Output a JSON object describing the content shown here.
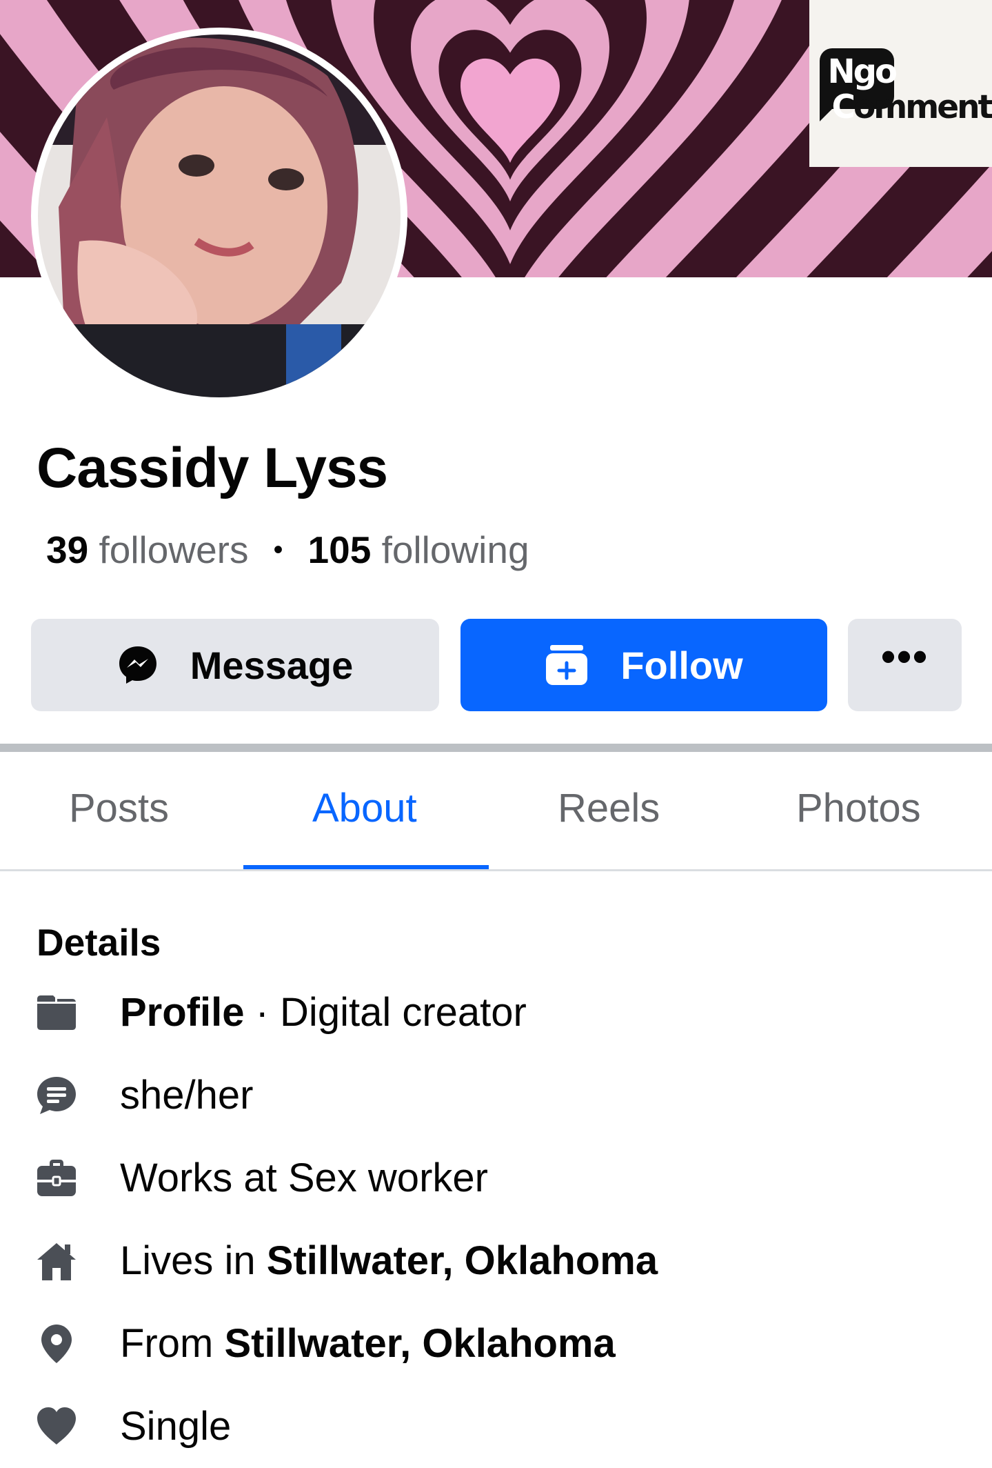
{
  "watermark": {
    "line1": "Ngo",
    "line2_first": "C",
    "line2_rest": "omment"
  },
  "profile": {
    "name": "Cassidy Lyss",
    "followers_count": "39",
    "followers_label": "followers",
    "separator": "•",
    "following_count": "105",
    "following_label": "following"
  },
  "actions": {
    "message_label": "Message",
    "follow_label": "Follow",
    "more_label": "•••"
  },
  "tabs": [
    {
      "label": "Posts",
      "active": false
    },
    {
      "label": "About",
      "active": true
    },
    {
      "label": "Reels",
      "active": false
    },
    {
      "label": "Photos",
      "active": false
    }
  ],
  "details": {
    "title": "Details",
    "profile_type_label": "Profile",
    "profile_type_value": " · Digital creator",
    "pronouns": "she/her",
    "work": "Works at Sex worker",
    "lives_prefix": "Lives in ",
    "lives_place": "Stillwater, Oklahoma",
    "from_prefix": "From ",
    "from_place": "Stillwater, Oklahoma",
    "relationship": "Single"
  },
  "colors": {
    "accent": "#0866ff",
    "button_gray": "#e4e6eb",
    "secondary_text": "#65676b",
    "icon_gray": "#4b4f56",
    "cover_pink": "#e7a6c8",
    "cover_dark": "#3a1424"
  },
  "icons": [
    "messenger-icon",
    "follow-add-icon",
    "more-icon",
    "profile-card-icon",
    "pronoun-bubble-icon",
    "briefcase-icon",
    "home-icon",
    "location-pin-icon",
    "heart-icon"
  ]
}
